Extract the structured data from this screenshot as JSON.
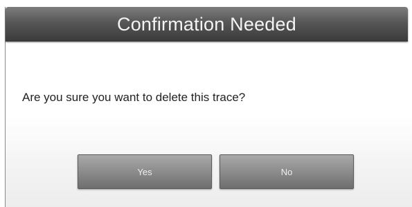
{
  "dialog": {
    "title": "Confirmation Needed",
    "message": "Are you sure you want to delete this trace?",
    "buttons": {
      "yes_label": "Yes",
      "no_label": "No"
    }
  },
  "colors": {
    "titlebar": "#4a4a4a",
    "button": "#8c8c8c",
    "title_text": "#f4f4f4"
  }
}
